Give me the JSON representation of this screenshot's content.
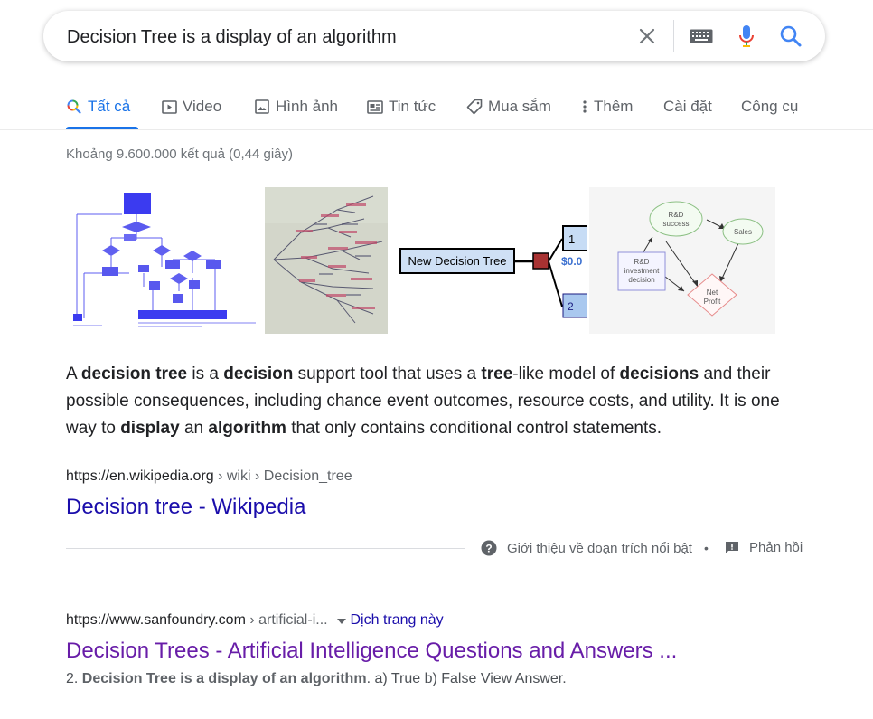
{
  "search": {
    "query": "Decision Tree is a display of an algorithm"
  },
  "tabs": [
    {
      "label": "Tất cả",
      "icon": "search-icon",
      "active": true
    },
    {
      "label": "Video",
      "icon": "video-icon"
    },
    {
      "label": "Hình ảnh",
      "icon": "image-icon"
    },
    {
      "label": "Tin tức",
      "icon": "news-icon"
    },
    {
      "label": "Mua sắm",
      "icon": "shopping-tag-icon"
    },
    {
      "label": "Thêm",
      "icon": "more-vert-icon"
    },
    {
      "label": "Cài đặt"
    },
    {
      "label": "Công cụ"
    }
  ],
  "stats": "Khoảng 9.600.000 kết quả (0,44 giây)",
  "images": {
    "diagram3": {
      "node_label": "New Decision Tree",
      "value": "$0.0",
      "branch1": "1",
      "branch2": "2"
    },
    "diagram4": {
      "node_a": "R&D",
      "node_a2": "success",
      "node_b": "Sales",
      "node_c1": "R&D",
      "node_c2": "investment",
      "node_c3": "decision",
      "node_d1": "Net",
      "node_d2": "Profit"
    }
  },
  "featured": {
    "snippet": [
      {
        "t": "A "
      },
      {
        "t": "decision tree",
        "b": true
      },
      {
        "t": " is a "
      },
      {
        "t": "decision",
        "b": true
      },
      {
        "t": " support tool that uses a "
      },
      {
        "t": "tree",
        "b": true
      },
      {
        "t": "-like model of "
      },
      {
        "t": "decisions",
        "b": true
      },
      {
        "t": " and their possible consequences, including chance event outcomes, resource costs, and utility. It is one way to "
      },
      {
        "t": "display",
        "b": true
      },
      {
        "t": " an "
      },
      {
        "t": "algorithm",
        "b": true
      },
      {
        "t": " that only contains conditional control statements."
      }
    ],
    "cite_domain": "https://en.wikipedia.org",
    "cite_path": " › wiki › Decision_tree",
    "title": "Decision tree - Wikipedia",
    "about_label": "Giới thiệu về đoạn trích nổi bật",
    "dot": "•",
    "feedback_label": "Phản hồi"
  },
  "result2": {
    "cite_domain": "https://www.sanfoundry.com",
    "cite_path": " › artificial-i...",
    "translate_label": "Dịch trang này",
    "title": "Decision Trees - Artificial Intelligence Questions and Answers ...",
    "desc_prefix": "2. ",
    "desc_bold": "Decision Tree is a display of an algorithm",
    "desc_suffix": ". a) True b) False View Answer."
  },
  "colors": {
    "link": "#1a0dab",
    "visited": "#681da8",
    "accent": "#1a73e8",
    "muted": "#5f6368"
  }
}
